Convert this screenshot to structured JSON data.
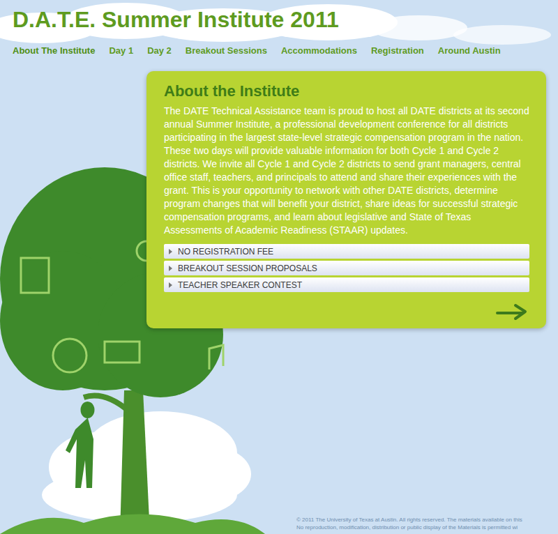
{
  "page": {
    "title": "D.A.T.E. Summer Institute 2011"
  },
  "nav": [
    {
      "label": "About The Institute",
      "selected": true
    },
    {
      "label": "Day 1",
      "selected": false
    },
    {
      "label": "Day 2",
      "selected": false
    },
    {
      "label": "Breakout Sessions",
      "selected": false
    },
    {
      "label": "Accommodations",
      "selected": false
    },
    {
      "label": "Registration",
      "selected": false
    },
    {
      "label": "Around Austin",
      "selected": false
    }
  ],
  "panel": {
    "heading": "About the Institute",
    "body": "The DATE Technical Assistance team is proud to host all DATE districts at its second annual Summer Institute, a professional development conference for all districts participating in the largest state-level strategic compensation program in the nation. These two days will provide valuable information for both Cycle 1 and Cycle 2 districts. We invite all Cycle 1 and Cycle 2 districts to send grant managers, central office staff, teachers, and principals to attend and share their experiences with the grant. This is your opportunity to network with other DATE districts, determine program changes that will benefit your district, share ideas for successful strategic compensation programs, and learn about legislative and State of Texas Assessments of Academic Readiness (STAAR) updates.",
    "accordion": [
      {
        "label": "NO REGISTRATION FEE",
        "expanded": false
      },
      {
        "label": "BREAKOUT SESSION PROPOSALS",
        "expanded": false
      },
      {
        "label": "TEACHER SPEAKER CONTEST",
        "expanded": false
      }
    ]
  },
  "footer": [
    "© 2011 The University of Texas at Austin. All rights reserved. The materials available on this",
    "No reproduction, modification, distribution or public display of the Materials is permitted wi"
  ]
}
